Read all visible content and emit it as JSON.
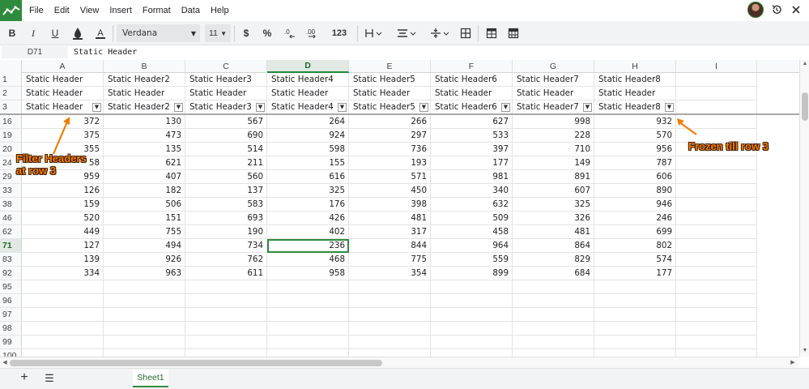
{
  "menu": {
    "items": [
      "File",
      "Edit",
      "View",
      "Insert",
      "Format",
      "Data",
      "Help"
    ]
  },
  "toolbar": {
    "font_name": "Verdana",
    "font_size": "11",
    "currency_label": "$",
    "percent_label": "%",
    "number_format_label": "123"
  },
  "formula_bar": {
    "cell_ref": "D71",
    "content": "Static Header"
  },
  "grid": {
    "columns": [
      "A",
      "B",
      "C",
      "D",
      "E",
      "F",
      "G",
      "H",
      "I"
    ],
    "active_column": "D",
    "header_rows": [
      {
        "row": "1",
        "cells": [
          "Static Header",
          "Static Header2",
          "Static Header3",
          "Static Header4",
          "Static Header5",
          "Static Header6",
          "Static Header7",
          "Static Header8",
          ""
        ]
      },
      {
        "row": "2",
        "cells": [
          "Static Header",
          "Static Header",
          "Static Header",
          "Static Header",
          "Static Header",
          "Static Header",
          "Static Header",
          "Static Header",
          ""
        ]
      },
      {
        "row": "3",
        "cells": [
          "Static Header",
          "Static Header2",
          "Static Header3",
          "Static Header4",
          "Static Header5",
          "Static Header6",
          "Static Header7",
          "Static Header8",
          ""
        ]
      }
    ],
    "data_rows": [
      {
        "row": "16",
        "cells": [
          "372",
          "130",
          "567",
          "264",
          "266",
          "627",
          "998",
          "932",
          ""
        ]
      },
      {
        "row": "19",
        "cells": [
          "375",
          "473",
          "690",
          "924",
          "297",
          "533",
          "228",
          "570",
          ""
        ]
      },
      {
        "row": "20",
        "cells": [
          "355",
          "135",
          "514",
          "598",
          "736",
          "397",
          "710",
          "956",
          ""
        ]
      },
      {
        "row": "24",
        "cells": [
          "58",
          "621",
          "211",
          "155",
          "193",
          "177",
          "149",
          "787",
          ""
        ]
      },
      {
        "row": "29",
        "cells": [
          "959",
          "407",
          "560",
          "616",
          "571",
          "981",
          "891",
          "606",
          ""
        ]
      },
      {
        "row": "33",
        "cells": [
          "126",
          "182",
          "137",
          "325",
          "450",
          "340",
          "607",
          "890",
          ""
        ]
      },
      {
        "row": "38",
        "cells": [
          "159",
          "506",
          "583",
          "176",
          "398",
          "632",
          "325",
          "946",
          ""
        ]
      },
      {
        "row": "46",
        "cells": [
          "520",
          "151",
          "693",
          "426",
          "481",
          "509",
          "326",
          "246",
          ""
        ]
      },
      {
        "row": "62",
        "cells": [
          "449",
          "755",
          "190",
          "402",
          "317",
          "458",
          "481",
          "699",
          ""
        ]
      },
      {
        "row": "71",
        "cells": [
          "127",
          "494",
          "734",
          "236",
          "844",
          "964",
          "864",
          "802",
          ""
        ]
      },
      {
        "row": "83",
        "cells": [
          "139",
          "926",
          "762",
          "468",
          "775",
          "559",
          "829",
          "574",
          ""
        ]
      },
      {
        "row": "92",
        "cells": [
          "334",
          "963",
          "611",
          "958",
          "354",
          "899",
          "684",
          "177",
          ""
        ]
      },
      {
        "row": "95",
        "cells": [
          "",
          "",
          "",
          "",
          "",
          "",
          "",
          "",
          ""
        ]
      },
      {
        "row": "96",
        "cells": [
          "",
          "",
          "",
          "",
          "",
          "",
          "",
          "",
          ""
        ]
      },
      {
        "row": "97",
        "cells": [
          "",
          "",
          "",
          "",
          "",
          "",
          "",
          "",
          ""
        ]
      },
      {
        "row": "98",
        "cells": [
          "",
          "",
          "",
          "",
          "",
          "",
          "",
          "",
          ""
        ]
      },
      {
        "row": "99",
        "cells": [
          "",
          "",
          "",
          "",
          "",
          "",
          "",
          "",
          ""
        ]
      },
      {
        "row": "100",
        "cells": [
          "",
          "",
          "",
          "",
          "",
          "",
          "",
          "",
          ""
        ]
      }
    ],
    "active_row": "71"
  },
  "annotations": {
    "filter_line1": "Filter Headers",
    "filter_line2": "at row 3",
    "frozen": "Frozen till row 3",
    "color": "#f57c00"
  },
  "sheets": {
    "tabs": [
      "Sheet1"
    ],
    "active": "Sheet1"
  },
  "colors": {
    "accent": "#2e8b3e",
    "active_header_bg": "#e2e8e3"
  }
}
